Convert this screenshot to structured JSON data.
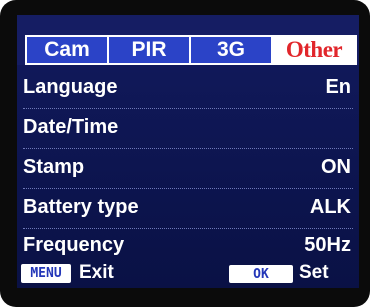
{
  "tabs": [
    {
      "label": "Cam",
      "active": false
    },
    {
      "label": "PIR",
      "active": false
    },
    {
      "label": "3G",
      "active": false
    },
    {
      "label": "Other",
      "active": true
    }
  ],
  "settings": [
    {
      "label": "Language",
      "value": "En"
    },
    {
      "label": "Date/Time",
      "value": ""
    },
    {
      "label": "Stamp",
      "value": "ON"
    },
    {
      "label": "Battery type",
      "value": "ALK"
    },
    {
      "label": "Frequency",
      "value": "50Hz"
    }
  ],
  "footer": {
    "menu_key": "MENU",
    "exit_label": "Exit",
    "ok_key": "OK",
    "set_label": "Set"
  },
  "colors": {
    "screen_bg": "#121a5e",
    "tab_bg": "#2b43c7",
    "active_tab_text": "#e1262b",
    "text": "#ffffff"
  }
}
